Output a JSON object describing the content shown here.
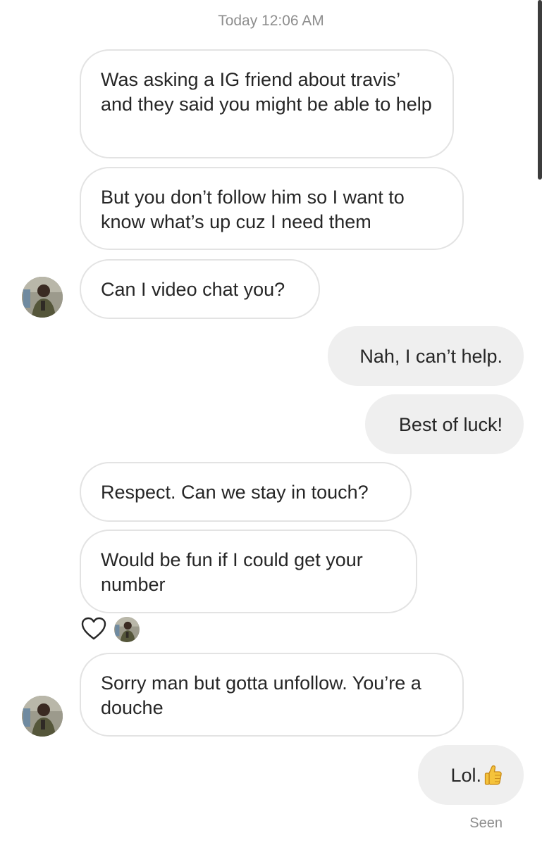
{
  "conversation": {
    "timestamp": "Today 12:06 AM",
    "messages": [
      {
        "text": "Was asking a IG friend about travis’ and they said you might be able to help"
      },
      {
        "text": "But you don’t follow him so I want to know what’s up cuz I need them"
      },
      {
        "text": "Can I video chat you?"
      },
      {
        "text": "Nah, I can’t help."
      },
      {
        "text": "Best of luck!"
      },
      {
        "text": "Respect. Can we stay in touch?"
      },
      {
        "text": "Would be fun if I could get your number"
      },
      {
        "text": "Sorry man but gotta unfollow. You’re a douche"
      },
      {
        "text": "Lol.",
        "emoji": "thumbs-up-icon"
      }
    ],
    "seen_label": "Seen"
  },
  "colors": {
    "incoming_bg": "#ffffff",
    "incoming_border": "#e3e3e3",
    "outgoing_bg": "#efefef",
    "meta_text": "#8e8e8e"
  }
}
